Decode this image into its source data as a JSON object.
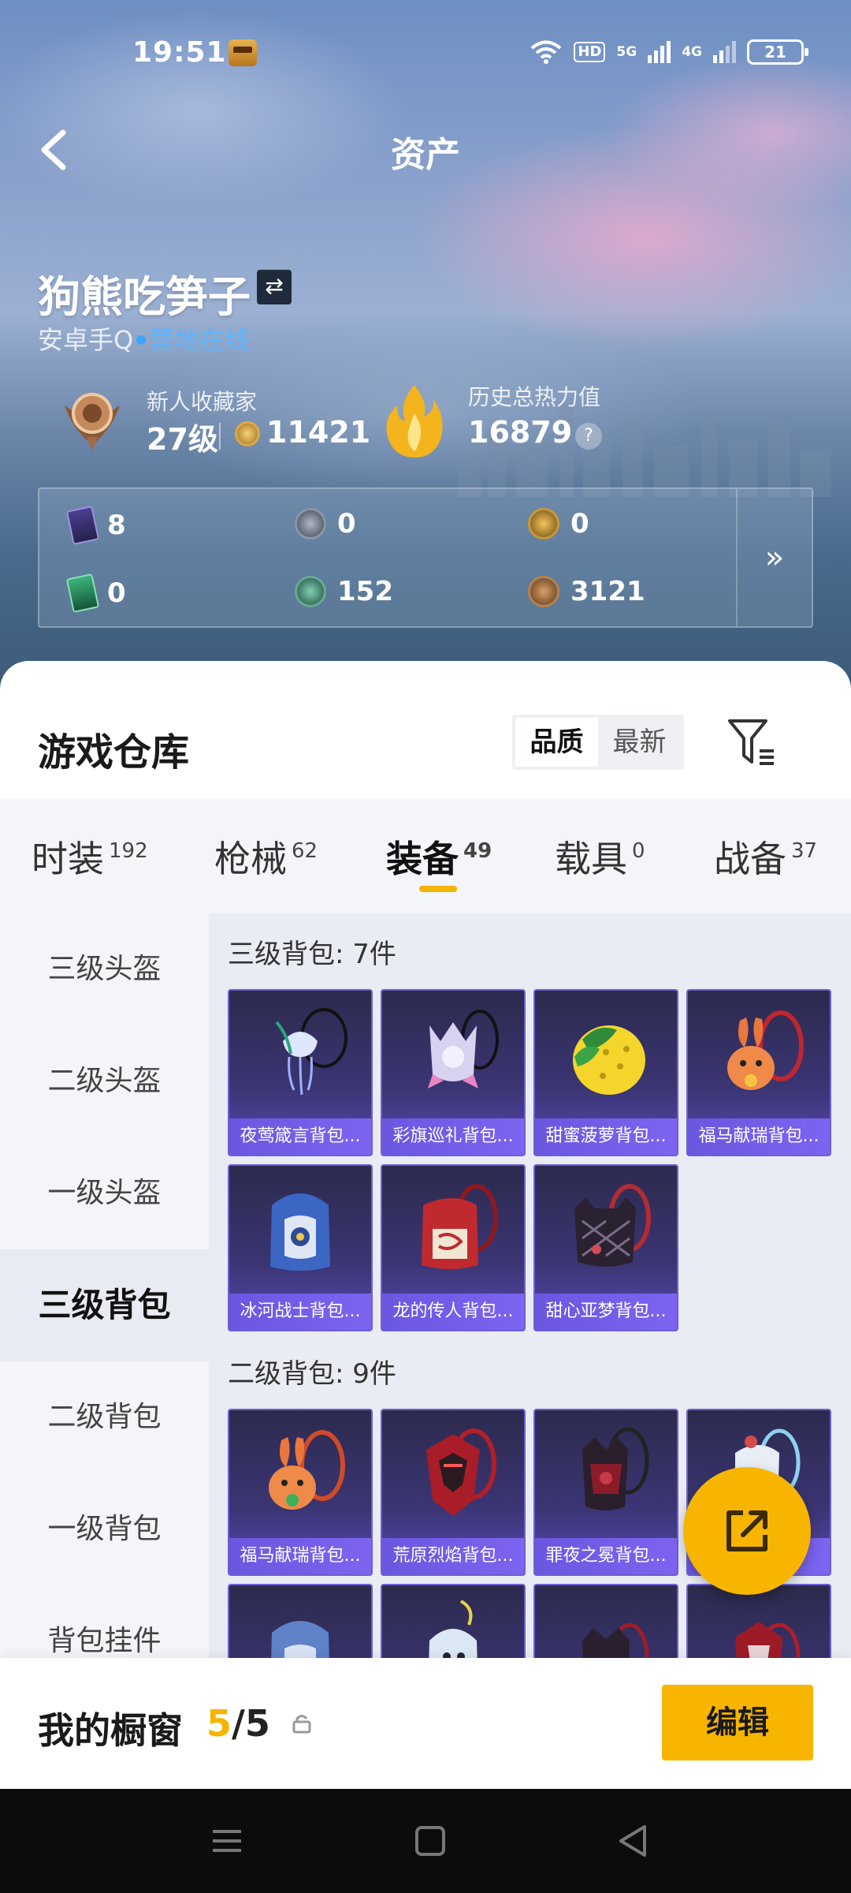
{
  "status_bar": {
    "time": "19:51",
    "hd": "HD",
    "net1": "5G",
    "net2": "4G",
    "battery": "21"
  },
  "header": {
    "title": "资产"
  },
  "player": {
    "name": "狗熊吃笋子",
    "platform": "安卓手Q",
    "status": "营地在线",
    "rank_title": "新人收藏家",
    "rank_level": "27级",
    "rank_points": "11421",
    "heat_label": "历史总热力值",
    "heat_value": "16879",
    "help": "?"
  },
  "currencies": [
    {
      "icon": "purple-card-icon",
      "value": "8"
    },
    {
      "icon": "silver-coin-icon",
      "value": "0"
    },
    {
      "icon": "gold-coin-icon",
      "value": "0"
    },
    {
      "icon": "green-card-icon",
      "value": "0"
    },
    {
      "icon": "teal-coin-icon",
      "value": "152"
    },
    {
      "icon": "bronze-coin-icon",
      "value": "3121"
    }
  ],
  "currency_more": "»",
  "warehouse": {
    "title": "游戏仓库",
    "sort_options": [
      "品质",
      "最新"
    ],
    "sort_active": "品质"
  },
  "tabs": [
    {
      "label": "时装",
      "count": "192"
    },
    {
      "label": "枪械",
      "count": "62"
    },
    {
      "label": "装备",
      "count": "49"
    },
    {
      "label": "载具",
      "count": "0"
    },
    {
      "label": "战备",
      "count": "37"
    }
  ],
  "sidebar": [
    "三级头盔",
    "二级头盔",
    "一级头盔",
    "三级背包",
    "二级背包",
    "一级背包",
    "背包挂件"
  ],
  "groups": [
    {
      "label": "三级背包: 7件",
      "items": [
        "夜莺箴言背包...",
        "彩旗巡礼背包...",
        "甜蜜菠萝背包...",
        "福马献瑞背包...",
        "冰河战士背包...",
        "龙的传人背包...",
        "甜心亚梦背包..."
      ]
    },
    {
      "label": "二级背包: 9件",
      "items": [
        "福马献瑞背包...",
        "荒原烈焰背包...",
        "罪夜之冕背包...",
        "...",
        "",
        "",
        "",
        ""
      ]
    }
  ],
  "showcase": {
    "label": "我的橱窗",
    "current": "5",
    "total": "/5"
  },
  "edit_button": "编辑",
  "colors": {
    "accent": "#f7b500",
    "item_bg": "#3b3574",
    "online": "#3da4ff"
  }
}
